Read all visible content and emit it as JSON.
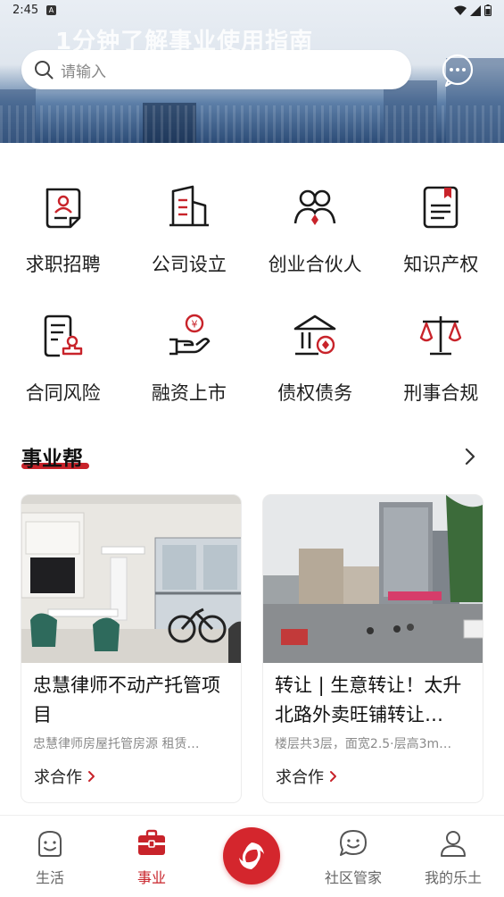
{
  "status_bar": {
    "time": "2:45",
    "badge": "A"
  },
  "banner": {
    "title": "1分钟了解事业使用指南"
  },
  "search": {
    "placeholder": "请输入"
  },
  "categories": [
    {
      "label": "求职招聘",
      "icon": "resume-icon"
    },
    {
      "label": "公司设立",
      "icon": "building-icon"
    },
    {
      "label": "创业合伙人",
      "icon": "partners-icon"
    },
    {
      "label": "知识产权",
      "icon": "document-bookmark-icon"
    },
    {
      "label": "合同风险",
      "icon": "contract-stamp-icon"
    },
    {
      "label": "融资上市",
      "icon": "hand-coin-icon"
    },
    {
      "label": "债权债务",
      "icon": "bank-icon"
    },
    {
      "label": "刑事合规",
      "icon": "scales-icon"
    }
  ],
  "section": {
    "title": "事业帮"
  },
  "cards": [
    {
      "title": "忠慧律师不动产托管项目",
      "desc": "忠慧律师房屋托管房源 租赁…",
      "action": "求合作"
    },
    {
      "title": "转让 | 生意转让！太升北路外卖旺铺转让…",
      "desc": "楼层共3层，面宽2.5·层高3m…",
      "action": "求合作"
    }
  ],
  "bottom_nav": {
    "items": [
      {
        "label": "生活",
        "icon": "smile-face-icon"
      },
      {
        "label": "事业",
        "icon": "briefcase-icon",
        "active": true
      },
      {
        "label": "社区管家",
        "icon": "chat-face-icon"
      },
      {
        "label": "我的乐土",
        "icon": "user-icon"
      }
    ]
  },
  "colors": {
    "accent": "#c8232a",
    "text": "#1a1a1a",
    "muted": "#8a8a8a"
  }
}
